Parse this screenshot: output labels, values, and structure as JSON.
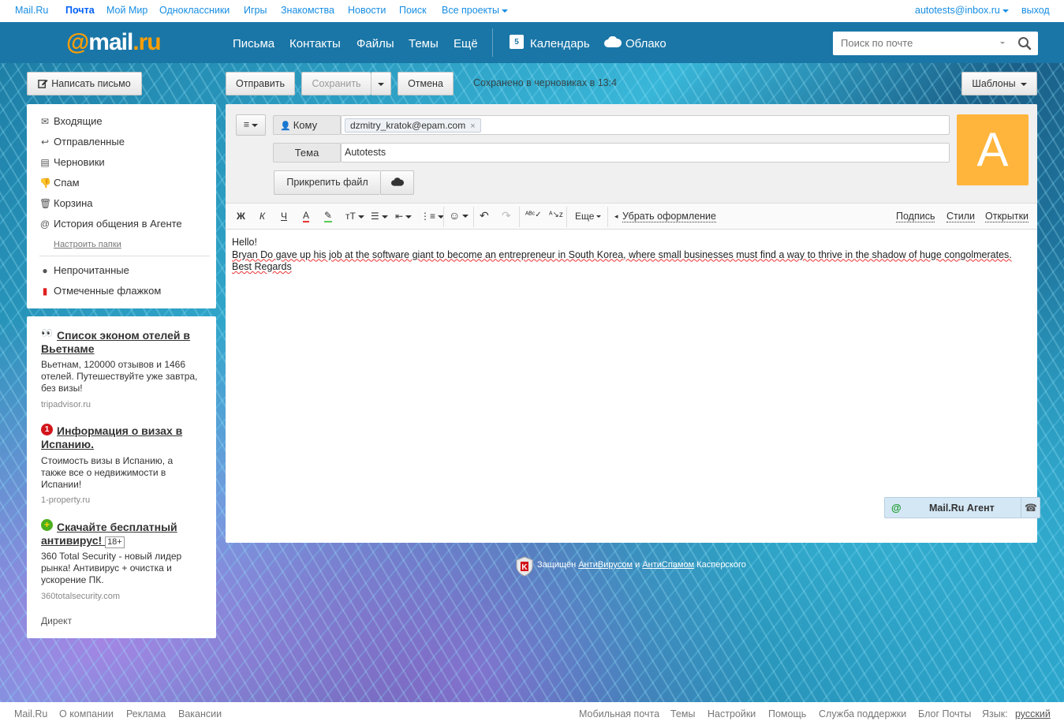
{
  "topbar": {
    "links": [
      "Mail.Ru",
      "Почта",
      "Мой Мир",
      "Одноклассники",
      "Игры",
      "Знакомства",
      "Новости",
      "Поиск",
      "Все проекты"
    ],
    "user_email": "autotests@inbox.ru",
    "logout": "выход"
  },
  "header": {
    "logo_at": "@",
    "logo_text": "mail",
    "logo_dot": ".ru",
    "nav": [
      "Письма",
      "Контакты",
      "Файлы",
      "Темы",
      "Ещё"
    ],
    "calendar_day": "5",
    "calendar": "Календарь",
    "cloud": "Облако",
    "search_placeholder": "Поиск по почте"
  },
  "actions": {
    "compose": "Написать письмо",
    "send": "Отправить",
    "save": "Сохранить",
    "cancel": "Отмена",
    "saved_status": "Сохранено в черновиках в 13:4",
    "templates": "Шаблоны"
  },
  "folders": {
    "items": [
      "Входящие",
      "Отправленные",
      "Черновики",
      "Спам",
      "Корзина",
      "История общения в Агенте"
    ],
    "configure": "Настроить папки",
    "filters": [
      "Непрочитанные",
      "Отмеченные флажком"
    ]
  },
  "ads": [
    {
      "title": "Список эконом отелей в Вьетнаме",
      "text": "Вьетнам, 120000 отзывов и 1466 отелей. Путешествуйте уже завтра, без визы!",
      "domain": "tripadvisor.ru"
    },
    {
      "title": "Информация о визах в Испанию.",
      "text": "Стоимость визы в Испанию, а также все о недвижимости в Испании!",
      "domain": "1-property.ru"
    },
    {
      "title": "Скачайте бесплатный антивирус!",
      "badge": "18+",
      "text": "360 Total Security - новый лидер рынка! Антивирус + очистка и ускорение ПК.",
      "domain": "360totalsecurity.com"
    }
  ],
  "ads_footer": "Директ",
  "compose": {
    "to_label": "Кому",
    "recipient": "dzmitry_kratok@epam.com",
    "subject_label": "Тема",
    "subject": "Autotests",
    "attach": "Прикрепить файл",
    "avatar_letter": "A",
    "toolbar": {
      "bold": "Ж",
      "italic": "К",
      "underline": "Ч",
      "more": "Еще",
      "remove_format": "Убрать оформление",
      "signature": "Подпись",
      "styles": "Стили",
      "cards": "Открытки"
    },
    "body": {
      "line1": "Hello!",
      "line2": "Bryan Do gave up his job at the software giant to become an entrepreneur in South Korea, where small businesses must find a way to thrive in the shadow of huge congolmerates.",
      "line3": "Best Regards"
    }
  },
  "agent": {
    "at": "@",
    "name": "Mail.Ru Агент"
  },
  "kaspersky": {
    "prefix": "Защищён",
    "antivirus": "АнтиВирусом",
    "and": "и",
    "antispam": "АнтиСпамом",
    "suffix": "Касперского"
  },
  "footer": {
    "left": [
      "Mail.Ru",
      "О компании",
      "Реклама",
      "Вакансии"
    ],
    "right": [
      "Мобильная почта",
      "Темы",
      "Настройки",
      "Помощь",
      "Служба поддержки",
      "Блог Почты"
    ],
    "lang_label": "Язык:",
    "lang": "русский"
  },
  "colors": {
    "header_bg": "#1a76a7",
    "logo_orange": "#ff9e00",
    "link_blue": "#168de2",
    "avatar_bg": "#ffb53c"
  }
}
